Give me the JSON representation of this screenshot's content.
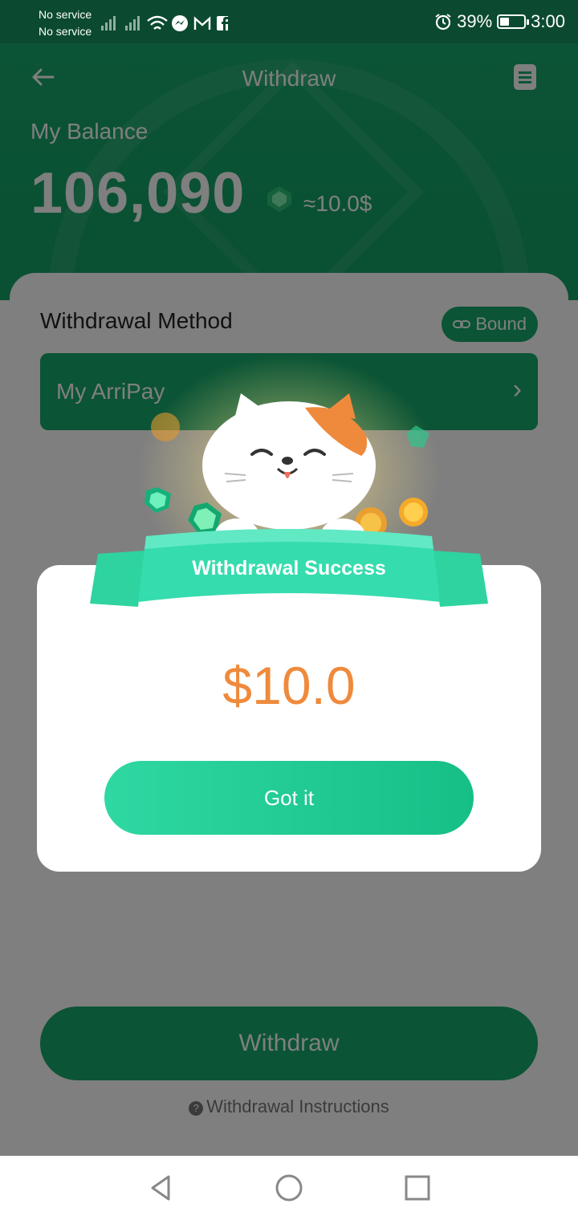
{
  "status_bar": {
    "carrier_line1": "No service",
    "carrier_line2": "No service",
    "battery_percent": "39%",
    "battery_level": 0.39,
    "time": "3:00",
    "icons": [
      "signal-icon",
      "signal-icon",
      "wifi-icon",
      "messenger-icon",
      "gmail-icon",
      "facebook-icon",
      "alarm-icon",
      "battery-icon"
    ]
  },
  "header": {
    "title": "Withdraw"
  },
  "balance": {
    "label": "My Balance",
    "value": "106,090",
    "approx": "≈10.0$"
  },
  "withdrawal_method": {
    "label": "Withdrawal Method",
    "bound_label": "Bound",
    "method_name": "My ArriPay"
  },
  "footer": {
    "withdraw_label": "Withdraw",
    "instructions_label": "Withdrawal Instructions"
  },
  "dialog": {
    "ribbon_title": "Withdrawal Success",
    "amount": "$10.0",
    "button_label": "Got it"
  },
  "colors": {
    "brand_green": "#17a86a",
    "amount_orange": "#ef8a3c",
    "button_gradient_start": "#2fd8a2",
    "button_gradient_end": "#15bf86"
  }
}
